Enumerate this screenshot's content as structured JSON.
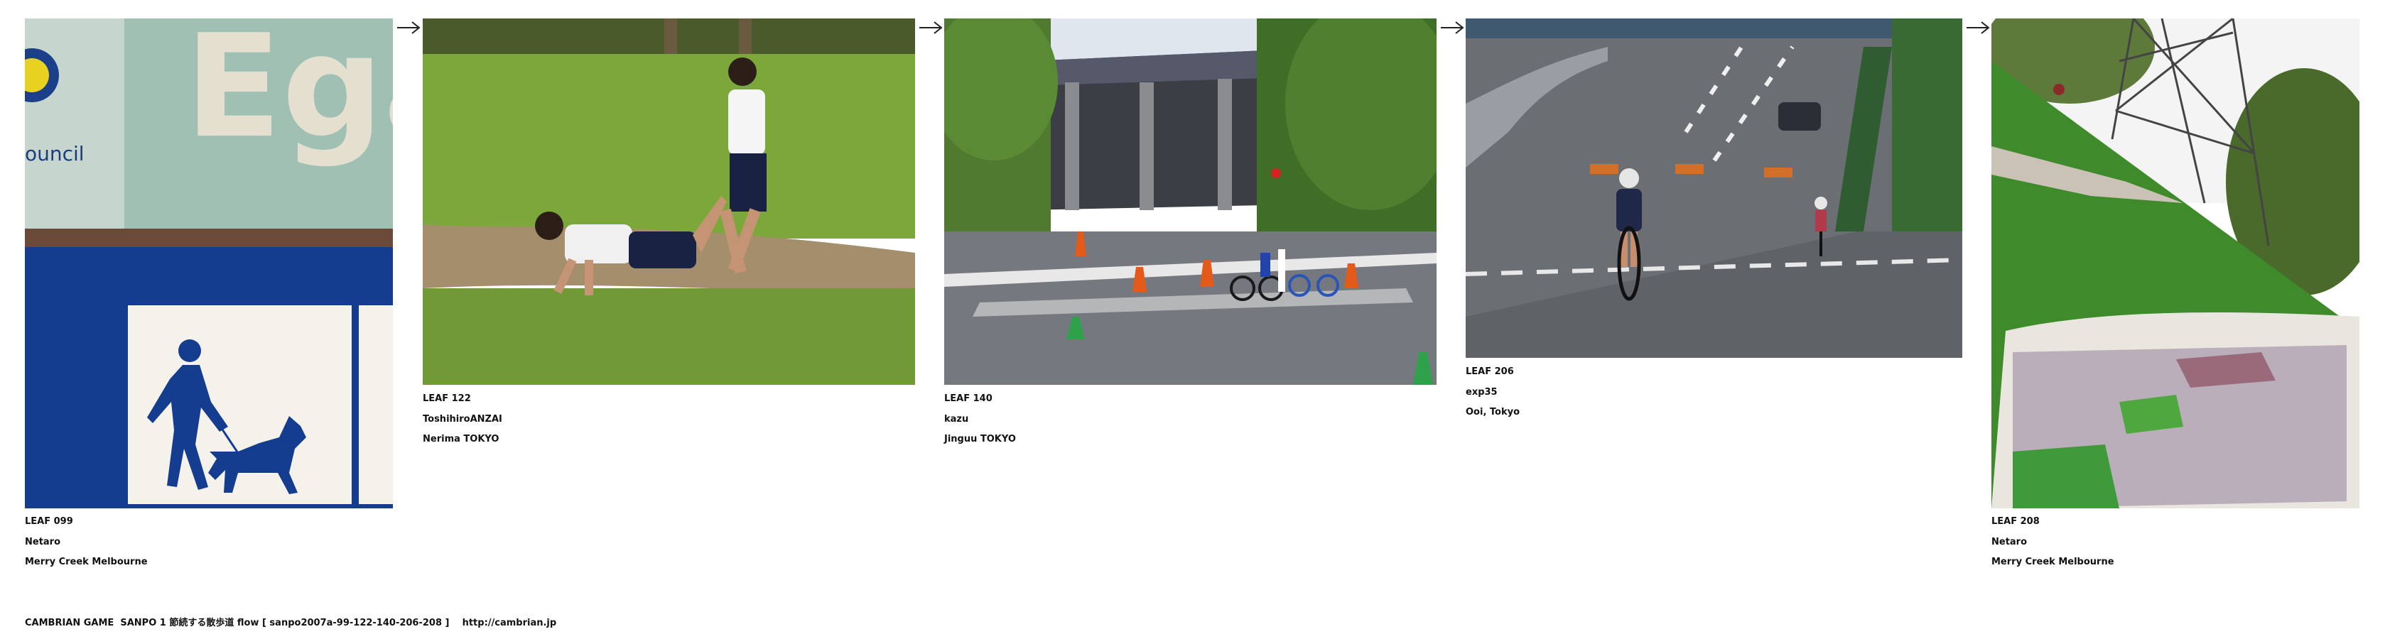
{
  "flow": {
    "leaves": [
      {
        "leaf": "LEAF 099",
        "author": "Netaro",
        "place": "Merry Creek Melbourne",
        "photo_icon": "walking-dog-sign-photo"
      },
      {
        "leaf": "LEAF 122",
        "author": "ToshihiroANZAI",
        "place": "Nerima TOKYO",
        "photo_icon": "wheelbarrow-boys-photo"
      },
      {
        "leaf": "LEAF 140",
        "author": "kazu",
        "place": "Jinguu TOKYO",
        "photo_icon": "stadium-cyclists-photo"
      },
      {
        "leaf": "LEAF 206",
        "author": "exp35",
        "place": "Ooi, Tokyo",
        "photo_icon": "road-cyclist-photo"
      },
      {
        "leaf": "LEAF 208",
        "author": "Netaro",
        "place": "Merry Creek Melbourne",
        "photo_icon": "grassy-slope-map-photo"
      }
    ],
    "arrow_icon": "right-arrow-icon"
  },
  "footer": {
    "text": "CAMBRIAN GAME  SANPO 1 節続する散歩道 flow [ sanpo2007a-99-122-140-206-208 ]    http://cambrian.jp"
  },
  "colors": {
    "sign_blue": "#143d8f",
    "sign_teal": "#8fb4a6",
    "grass": "#6f9a35",
    "asphalt": "#6b6e73"
  }
}
